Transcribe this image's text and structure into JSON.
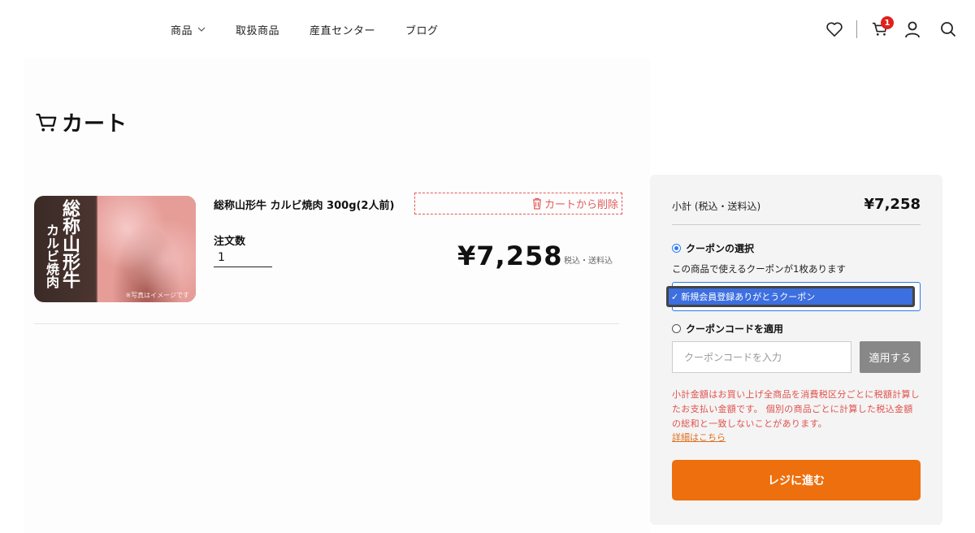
{
  "nav": {
    "items": [
      {
        "label": "商品",
        "has_dropdown": true
      },
      {
        "label": "取扱商品"
      },
      {
        "label": "産直センター"
      },
      {
        "label": "ブログ"
      }
    ]
  },
  "header": {
    "cart_badge": "1",
    "icons": [
      "heart-icon",
      "cart-icon",
      "user-icon",
      "search-icon"
    ]
  },
  "page": {
    "title": "カート"
  },
  "cart": {
    "item": {
      "name": "総称山形牛 カルビ焼肉 300g(2人前)",
      "image_text_big": "総称山形牛",
      "image_text_small": "カルビ焼肉",
      "image_footer": "※写真はイメージです",
      "remove_label": "カートから削除",
      "quantity_label": "注文数",
      "quantity": "1",
      "price": "¥7,258",
      "tax_note": "税込・送料込"
    }
  },
  "summary": {
    "subtotal_label": "小計 (税込・送料込)",
    "subtotal_value": "¥7,258",
    "coupon_select_label": "クーポンの選択",
    "coupon_note": "この商品で使えるクーポンが1枚あります",
    "coupon_selected": "新規会員登録ありがとうクーポン",
    "coupon_code_label": "クーポンコードを適用",
    "coupon_code_placeholder": "クーポンコードを入力",
    "apply_label": "適用する",
    "notice": "小計金額はお買い上げ全商品を消費税区分ごとに税額計算したお支払い金額です。 個別の商品ごとに計算した税込金額の総和と一致しないことがあります。",
    "details_link": "詳細はこちら",
    "checkout_label": "レジに進む"
  },
  "colors": {
    "accent_orange": "#ee6f0d",
    "warning_red": "#e0504c",
    "badge_red": "#e0201c",
    "select_blue": "#3c6fe0"
  }
}
